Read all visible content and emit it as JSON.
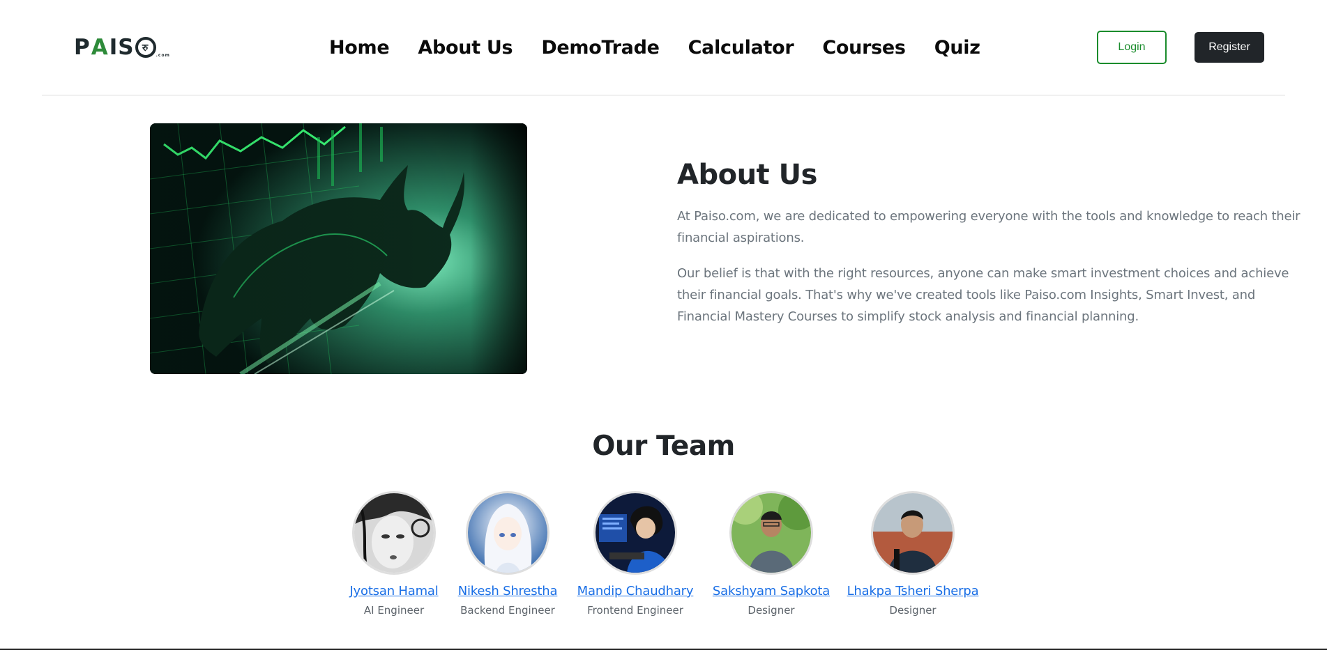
{
  "brand": {
    "logo_text_pre": "P",
    "logo_text_a": "A",
    "logo_text_mid": "IS",
    "logo_text_o": "रु",
    "logo_suffix": ".com",
    "accent_color": "#2e8b3a"
  },
  "nav": {
    "items": [
      {
        "label": "Home"
      },
      {
        "label": "About Us"
      },
      {
        "label": "DemoTrade"
      },
      {
        "label": "Calculator"
      },
      {
        "label": "Courses"
      },
      {
        "label": "Quiz"
      }
    ]
  },
  "auth": {
    "login_label": "Login",
    "register_label": "Register",
    "login_color": "#1a8c2c",
    "register_color": "#212529"
  },
  "about": {
    "title": "About Us",
    "paragraph_1": "At Paiso.com, we are dedicated to empowering everyone with the tools and knowledge to reach their financial aspirations.",
    "paragraph_2": "Our belief is that with the right resources, anyone can make smart investment choices and achieve their financial goals. That's why we've created tools like Paiso.com Insights, Smart Invest, and Financial Mastery Courses to simplify stock analysis and financial planning."
  },
  "team": {
    "title": "Our Team",
    "members": [
      {
        "name": "Jyotsan Hamal",
        "role": "AI Engineer"
      },
      {
        "name": "Nikesh Shrestha",
        "role": "Backend Engineer"
      },
      {
        "name": "Mandip Chaudhary",
        "role": "Frontend Engineer"
      },
      {
        "name": "Sakshyam Sapkota",
        "role": "Designer"
      },
      {
        "name": "Lhakpa Tsheri Sherpa",
        "role": "Designer"
      }
    ],
    "link_color": "#1a6fe6"
  }
}
